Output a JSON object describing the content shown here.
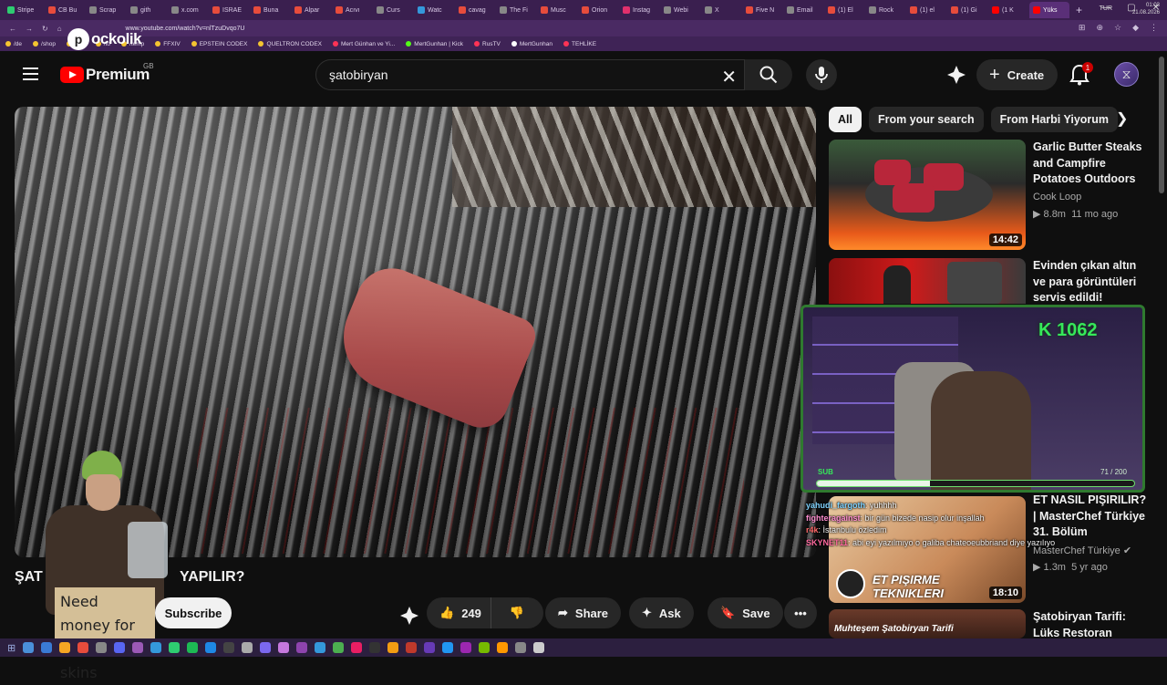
{
  "browser": {
    "tabs": [
      {
        "label": "Stripe",
        "color": "#2ecc71"
      },
      {
        "label": "CB Bu",
        "color": "#e74c3c"
      },
      {
        "label": "Scrap",
        "color": "#888888"
      },
      {
        "label": "gith",
        "color": "#888888"
      },
      {
        "label": "x.com",
        "color": "#888888"
      },
      {
        "label": "ISRAE",
        "color": "#e74c3c"
      },
      {
        "label": "Buna",
        "color": "#e74c3c"
      },
      {
        "label": "Alpar",
        "color": "#e74c3c"
      },
      {
        "label": "Acıvı",
        "color": "#e74c3c"
      },
      {
        "label": "Curs",
        "color": "#888888"
      },
      {
        "label": "Watc",
        "color": "#3498db"
      },
      {
        "label": "cavag",
        "color": "#e74c3c"
      },
      {
        "label": "The Fi",
        "color": "#888888"
      },
      {
        "label": "Musc",
        "color": "#e74c3c"
      },
      {
        "label": "Orion",
        "color": "#e74c3c"
      },
      {
        "label": "Instag",
        "color": "#e1306c"
      },
      {
        "label": "Webi",
        "color": "#888888"
      },
      {
        "label": "X",
        "color": "#888888"
      },
      {
        "label": "Five N",
        "color": "#e74c3c"
      },
      {
        "label": "Email",
        "color": "#888888"
      },
      {
        "label": "(1) El",
        "color": "#e74c3c"
      },
      {
        "label": "Rock",
        "color": "#888888"
      },
      {
        "label": "(1) el",
        "color": "#e74c3c"
      },
      {
        "label": "(1) Gi",
        "color": "#e74c3c"
      },
      {
        "label": "(1 K",
        "color": "#ff0000"
      },
      {
        "label": "Yüks",
        "color": "#ff0000"
      }
    ],
    "url": "www.youtube.com/watch?v=nlTzuDvqo7U",
    "bookmarks": [
      {
        "label": "/de",
        "color": "#f4c430"
      },
      {
        "label": "/shop",
        "color": "#f4c430"
      },
      {
        "label": "/mu",
        "color": "#f4c430"
      },
      {
        "label": "/to",
        "color": "#f4c430"
      },
      {
        "label": "/temp",
        "color": "#f4c430"
      },
      {
        "label": "FFXIV",
        "color": "#f4c430"
      },
      {
        "label": "EPSTEIN CODEX",
        "color": "#f4c430"
      },
      {
        "label": "QUELTRON CODEX",
        "color": "#f4c430"
      },
      {
        "label": "Mert Günhan ve Yi...",
        "color": "#ff3355"
      },
      {
        "label": "MertGunhan | Kick",
        "color": "#53fc18"
      },
      {
        "label": "RusTV",
        "color": "#ff3355"
      },
      {
        "label": "MertGunhan",
        "color": "#ffffff"
      },
      {
        "label": "TEHLİKE",
        "color": "#ff3355"
      }
    ],
    "overlay_logo": "ockolik"
  },
  "header": {
    "logo_text": "Premium",
    "region": "GB",
    "search_value": "şatobiryan",
    "create_label": "Create",
    "notification_count": "1"
  },
  "video": {
    "title_start": "ŞAT",
    "title_end": "YAPILIR?",
    "subscribe_label": "Subscribe",
    "like_count": "249",
    "share_label": "Share",
    "ask_label": "Ask",
    "save_label": "Save",
    "overlay_sign": "Need money for Fortnite skins"
  },
  "chips": [
    {
      "label": "All",
      "active": true
    },
    {
      "label": "From your search",
      "active": false
    },
    {
      "label": "From Harbi Yiyorum",
      "active": false
    }
  ],
  "recommendations": [
    {
      "title": "Garlic Butter Steaks and Campfire Potatoes Outdoors",
      "channel": "Cook Loop",
      "views": "8.8m",
      "age": "11 mo ago",
      "duration": "14:42"
    },
    {
      "title": "Evinden çıkan altın ve para görüntüleri servis edildi! Alparslan ...",
      "channel": "",
      "views": "",
      "age": "",
      "duration": ""
    },
    {
      "title": "ET NASIL PIŞIRILIR? | MasterChef Türkiye 31. Bölüm",
      "channel": "MasterChef Türkiye",
      "views": "1.3m",
      "age": "5 yr ago",
      "duration": "18:10",
      "thumb_text": "ET PIŞIRME TEKNIKLERI"
    },
    {
      "title": "Şatobiryan Tarifi: Lüks Restoran Lezzetini",
      "channel": "",
      "views": "",
      "age": "",
      "duration": "",
      "thumb_text": "Muhteşem Şatobiryan Tarifi"
    }
  ],
  "stream_overlay": {
    "counter": "K 1062",
    "sub_label": "SUB",
    "goal_text": "71 / 200",
    "goal_progress": 0.355
  },
  "chat": [
    {
      "user": "yahudi_fargoth",
      "msg": ": yuhhhh",
      "color": "#7fd3ff"
    },
    {
      "user": "fighteragainst",
      "msg": ": bir gün bizede nasip olur inşallah",
      "color": "#ff8fd0"
    },
    {
      "user": "r4k",
      "msg": ": İstanbulu özledim",
      "color": "#ff6a6a"
    },
    {
      "user": "SKYNET11",
      "msg": ": abi eyi yazılmıyo o galiba chateoeubbriand diye yazılıyo",
      "color": "#ff6a9f"
    }
  ],
  "taskbar": {
    "lang": "TUR",
    "time": "01:03",
    "date": "21.08.2026"
  },
  "colors": {
    "accent_red": "#ff0000",
    "overlay_green": "#36e85a"
  }
}
